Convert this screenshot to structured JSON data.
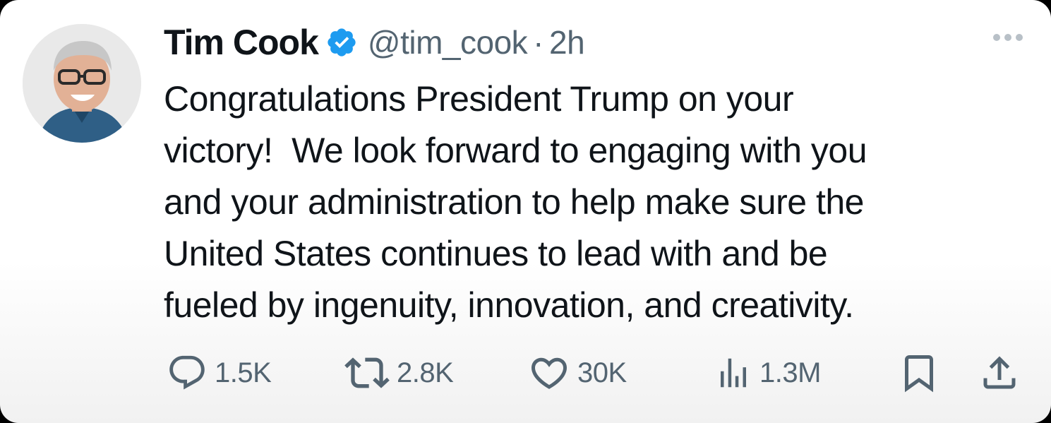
{
  "tweet": {
    "author_name": "Tim Cook",
    "handle": "@tim_cook",
    "separator": "·",
    "time": "2h",
    "verified_icon": "verified-badge-icon",
    "verified_color": "#1d9bf0",
    "text_lines": [
      "Congratulations President Trump on your",
      "victory!  We look forward to engaging with you",
      "and your administration to help make sure the",
      "United States continues to lead with and be",
      "fueled by ingenuity, innovation, and creativity."
    ]
  },
  "actions": {
    "replies": "1.5K",
    "retweets": "2.8K",
    "likes": "30K",
    "views": "1.3M"
  },
  "icons": {
    "reply": "reply-icon",
    "retweet": "retweet-icon",
    "like": "heart-icon",
    "views": "views-icon",
    "bookmark": "bookmark-icon",
    "share": "share-icon",
    "more": "more-options-icon"
  },
  "colors": {
    "text": "#0f1419",
    "secondary": "#536471",
    "verified": "#1d9bf0"
  }
}
